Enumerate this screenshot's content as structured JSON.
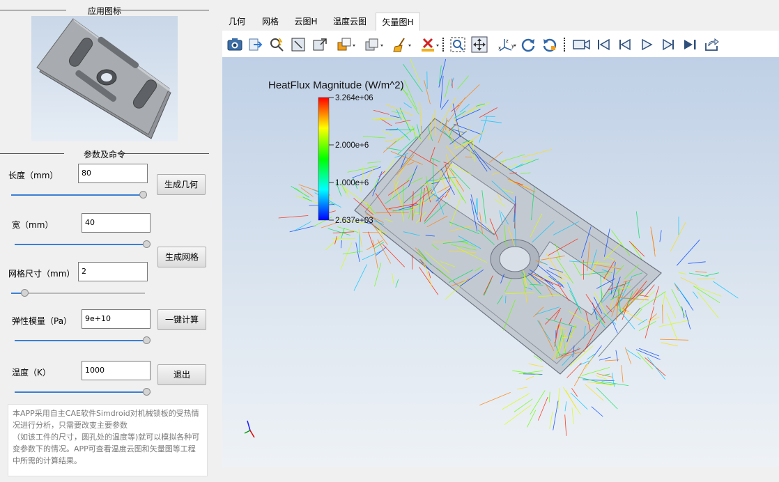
{
  "left_panel": {
    "app_icon_group_title": "应用图标",
    "params_group_title": "参数及命令",
    "fields": [
      {
        "label": "长度（mm）",
        "value": "80"
      },
      {
        "label": "宽（mm）",
        "value": "40"
      },
      {
        "label": "网格尺寸（mm）",
        "value": "2"
      },
      {
        "label": "弹性模量（Pa）",
        "value": "9e+10"
      },
      {
        "label": "温度（K）",
        "value": "1000"
      }
    ],
    "sliders": [
      0.97,
      1.0,
      0.1,
      1.0,
      1.0
    ],
    "buttons": {
      "generate_geometry": "生成几何",
      "generate_mesh": "生成网格",
      "compute": "一键计算",
      "exit": "退出"
    },
    "description": "本APP采用自主CAE软件Simdroid对机械锁板的受热情况进行分析，只需要改变主要参数\n（如该工件的尺寸，圆孔处的温度等)就可以模拟各种可变参数下的情况。APP可查看温度云图和矢量图等工程中所需的计算结果。"
  },
  "tabs": [
    "几何",
    "网格",
    "云图H",
    "温度云图",
    "矢量图H"
  ],
  "active_tab": 4,
  "toolbar_icons": [
    "camera-icon",
    "export-icon",
    "probe-icon",
    "fit-view-icon",
    "box-view-icon",
    "display-mode-icon",
    "surface-mode-icon",
    "clean-icon",
    "delete-icon",
    "zoom-box-icon",
    "pan-icon",
    "axes-icon",
    "rotate-cw-icon",
    "rotate-ccw-icon",
    "record-icon",
    "first-frame-icon",
    "prev-frame-icon",
    "play-icon",
    "next-frame-icon",
    "last-frame-icon",
    "export-animation-icon"
  ],
  "legend": {
    "title": "HeatFlux Magnitude (W/m^2)",
    "ticks": [
      "3.264e+06",
      "2.000e+6",
      "1.000e+6",
      "2.637e+03"
    ]
  },
  "colors": {
    "accent": "#3a7fd5",
    "viewport_top": "#bfd0e6",
    "viewport_bottom": "#eef2f6"
  }
}
